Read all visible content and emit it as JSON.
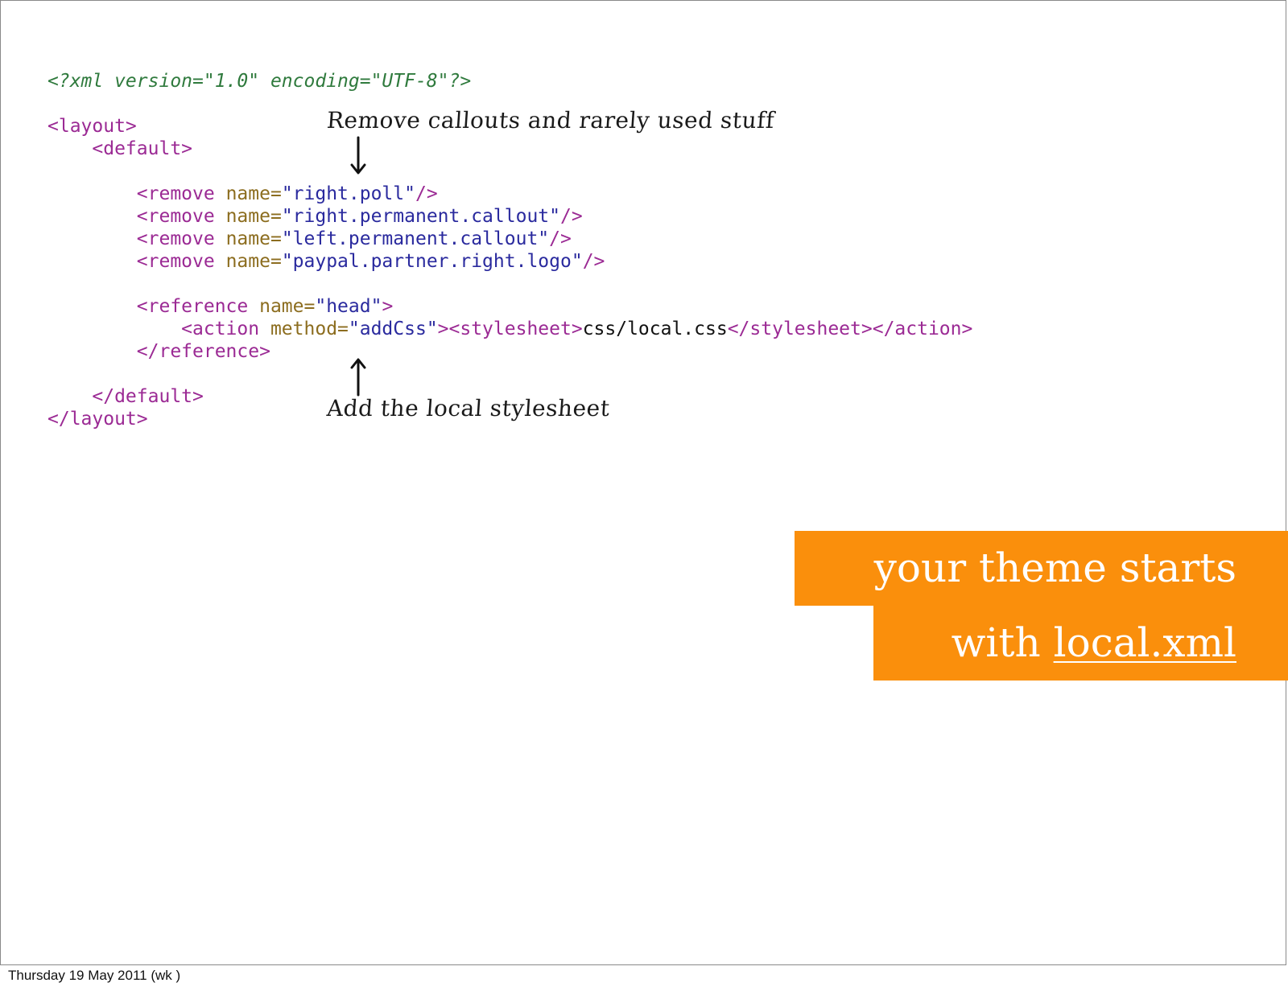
{
  "code_lines": [
    "<?xml version=\"1.0\" encoding=\"UTF-8\"?>",
    "",
    "<layout>",
    "<default>",
    "",
    "<remove name=\"right.poll\"/>",
    "<remove name=\"right.permanent.callout\"/>",
    "<remove name=\"left.permanent.callout\"/>",
    "<remove name=\"paypal.partner.right.logo\"/>",
    "",
    "<reference name=\"head\">",
    "<action method=\"addCss\"><stylesheet>css/local.css</stylesheet></action>",
    "</reference>",
    "",
    "</default>",
    "</layout>"
  ],
  "annotations": {
    "top": "Remove callouts and rarely used stuff",
    "bottom": "Add the local stylesheet"
  },
  "banner": {
    "line1": "your theme starts",
    "line2_prefix": "with ",
    "line2_link": "local.xml"
  },
  "footer": "Thursday 19 May 2011 (wk )",
  "colors": {
    "banner": "#fa8f0c",
    "xml_declaration": "#2f7a3d",
    "tag": "#9b2a94",
    "attribute": "#8c6d1f",
    "value": "#2a2a9e"
  }
}
